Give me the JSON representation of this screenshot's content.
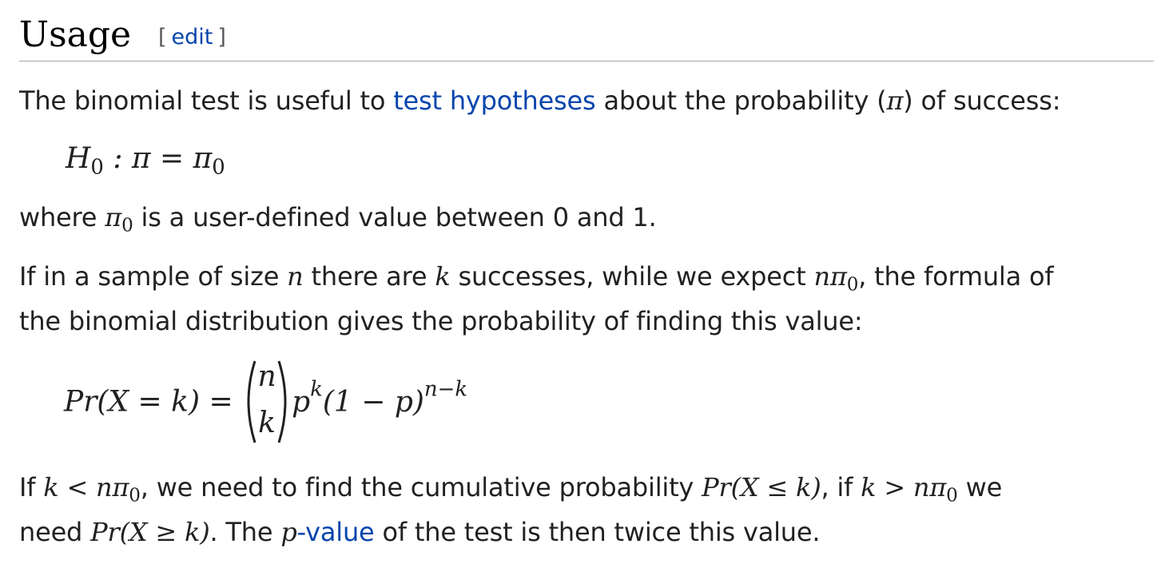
{
  "section": {
    "title": "Usage",
    "edit_open": "[",
    "edit_label": "edit",
    "edit_close": "]"
  },
  "para1": {
    "before": "The binomial test is useful to ",
    "link": "test hypotheses",
    "after_link": " about the probability (",
    "pi": "π",
    "end": ") of success:"
  },
  "eq1": {
    "H": "H",
    "sub0": "0",
    "rest": " : π = π",
    "sub1": "0"
  },
  "para2": {
    "before": "where ",
    "pi": "π",
    "sub": "0",
    "after": " is a user-defined value between 0 and 1."
  },
  "para3": {
    "a": "If in a sample of size ",
    "n": "n",
    "b": " there are ",
    "k": "k",
    "c": " successes, while we expect ",
    "npi": "nπ",
    "sub": "0",
    "d": ", the formula of",
    "line2": "the binomial distribution gives the probability of finding this value:"
  },
  "eq2": {
    "lhs": "Pr(X = k) = ",
    "binom_top": "n",
    "binom_bottom": "k",
    "p": "p",
    "p_exp": "k",
    "mid": "(1 − p)",
    "exp": "n−k"
  },
  "para4": {
    "a": "If ",
    "cond1": "k < nπ",
    "sub1": "0",
    "b": ", we need to find the cumulative probability ",
    "pr1": "Pr(X ≤ k)",
    "c": ", if ",
    "cond2": "k > nπ",
    "sub2": "0",
    "d": " we",
    "e": "need ",
    "pr2": "Pr(X ≥ k)",
    "f": ". The ",
    "pvar": "p",
    "link": "-value",
    "g": " of the test is then twice this value."
  }
}
